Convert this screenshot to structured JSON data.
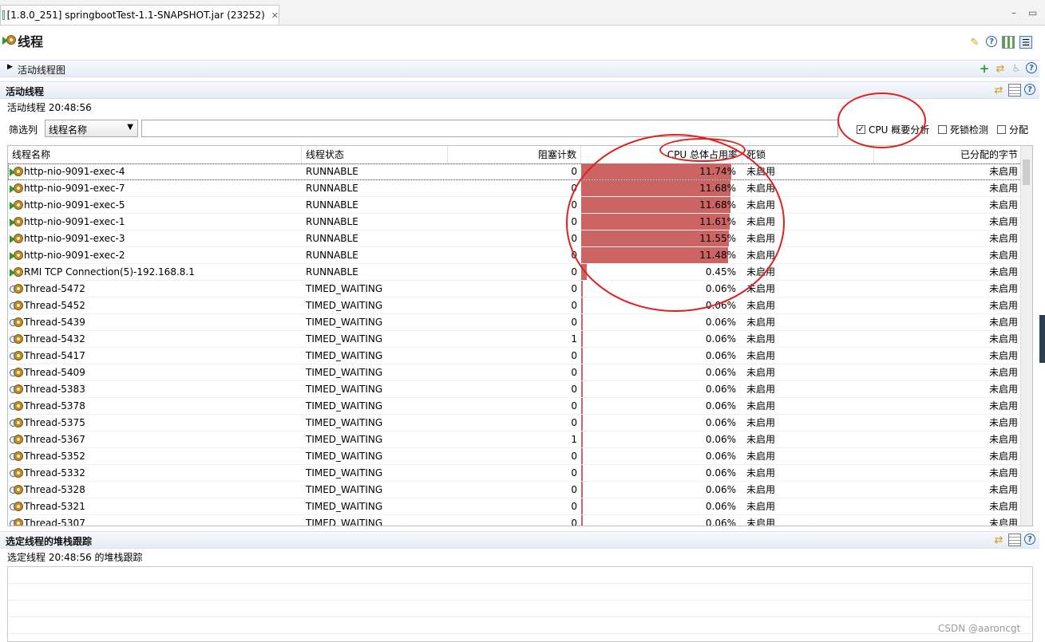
{
  "tab": {
    "title": "[1.8.0_251] springbootTest-1.1-SNAPSHOT.jar (23252)",
    "close_glyph": "✕"
  },
  "window": {
    "minimize_glyph": "–",
    "maximize_glyph": "▭"
  },
  "page": {
    "title": "线程"
  },
  "sections": {
    "thread_graph": {
      "title": "活动线程图"
    },
    "live_threads": {
      "title": "活动线程",
      "subtitle": "活动线程 20:48:56"
    },
    "stack_trace": {
      "title": "选定线程的堆栈跟踪",
      "subtitle": "选定线程 20:48:56 的堆栈跟踪"
    }
  },
  "filter": {
    "label": "筛选列",
    "column_selected": "线程名称",
    "input_value": "",
    "checkboxes": [
      {
        "label": "CPU 概要分析",
        "checked": true
      },
      {
        "label": "死锁检测",
        "checked": false
      },
      {
        "label": "分配",
        "checked": false
      }
    ]
  },
  "icons": {
    "page": "thread-icon",
    "header_toolbar": [
      "pin-icon",
      "help-icon",
      "layout-grid-icon",
      "layout-list-icon"
    ],
    "graph_toolbar": [
      "add-icon",
      "refresh-icon",
      "accessibility-icon",
      "help-icon"
    ],
    "section_toolbar": [
      "refresh-icon",
      "table-icon",
      "help-icon"
    ],
    "row_running": "running-thread-icon",
    "row_waiting": "waiting-thread-icon"
  },
  "table": {
    "columns": [
      "线程名称",
      "线程状态",
      "阻塞计数",
      "CPU 总体占用率",
      "死锁",
      "已分配的字节"
    ],
    "rows": [
      {
        "name": "http-nio-9091-exec-4",
        "state": "RUNNABLE",
        "blocked": "0",
        "cpu": "11.74%",
        "cpu_value": 11.74,
        "deadlock": "未启用",
        "bytes": "未启用",
        "running": true
      },
      {
        "name": "http-nio-9091-exec-7",
        "state": "RUNNABLE",
        "blocked": "0",
        "cpu": "11.68%",
        "cpu_value": 11.68,
        "deadlock": "未启用",
        "bytes": "未启用",
        "running": true
      },
      {
        "name": "http-nio-9091-exec-5",
        "state": "RUNNABLE",
        "blocked": "0",
        "cpu": "11.68%",
        "cpu_value": 11.68,
        "deadlock": "未启用",
        "bytes": "未启用",
        "running": true
      },
      {
        "name": "http-nio-9091-exec-1",
        "state": "RUNNABLE",
        "blocked": "0",
        "cpu": "11.61%",
        "cpu_value": 11.61,
        "deadlock": "未启用",
        "bytes": "未启用",
        "running": true
      },
      {
        "name": "http-nio-9091-exec-3",
        "state": "RUNNABLE",
        "blocked": "0",
        "cpu": "11.55%",
        "cpu_value": 11.55,
        "deadlock": "未启用",
        "bytes": "未启用",
        "running": true
      },
      {
        "name": "http-nio-9091-exec-2",
        "state": "RUNNABLE",
        "blocked": "0",
        "cpu": "11.48%",
        "cpu_value": 11.48,
        "deadlock": "未启用",
        "bytes": "未启用",
        "running": true
      },
      {
        "name": "RMI TCP Connection(5)-192.168.8.1",
        "state": "RUNNABLE",
        "blocked": "0",
        "cpu": "0.45%",
        "cpu_value": 0.45,
        "deadlock": "未启用",
        "bytes": "未启用",
        "running": true
      },
      {
        "name": "Thread-5472",
        "state": "TIMED_WAITING",
        "blocked": "0",
        "cpu": "0.06%",
        "cpu_value": 0.06,
        "deadlock": "未启用",
        "bytes": "未启用",
        "running": false
      },
      {
        "name": "Thread-5452",
        "state": "TIMED_WAITING",
        "blocked": "0",
        "cpu": "0.06%",
        "cpu_value": 0.06,
        "deadlock": "未启用",
        "bytes": "未启用",
        "running": false
      },
      {
        "name": "Thread-5439",
        "state": "TIMED_WAITING",
        "blocked": "0",
        "cpu": "0.06%",
        "cpu_value": 0.06,
        "deadlock": "未启用",
        "bytes": "未启用",
        "running": false
      },
      {
        "name": "Thread-5432",
        "state": "TIMED_WAITING",
        "blocked": "1",
        "cpu": "0.06%",
        "cpu_value": 0.06,
        "deadlock": "未启用",
        "bytes": "未启用",
        "running": false
      },
      {
        "name": "Thread-5417",
        "state": "TIMED_WAITING",
        "blocked": "0",
        "cpu": "0.06%",
        "cpu_value": 0.06,
        "deadlock": "未启用",
        "bytes": "未启用",
        "running": false
      },
      {
        "name": "Thread-5409",
        "state": "TIMED_WAITING",
        "blocked": "0",
        "cpu": "0.06%",
        "cpu_value": 0.06,
        "deadlock": "未启用",
        "bytes": "未启用",
        "running": false
      },
      {
        "name": "Thread-5383",
        "state": "TIMED_WAITING",
        "blocked": "0",
        "cpu": "0.06%",
        "cpu_value": 0.06,
        "deadlock": "未启用",
        "bytes": "未启用",
        "running": false
      },
      {
        "name": "Thread-5378",
        "state": "TIMED_WAITING",
        "blocked": "0",
        "cpu": "0.06%",
        "cpu_value": 0.06,
        "deadlock": "未启用",
        "bytes": "未启用",
        "running": false
      },
      {
        "name": "Thread-5375",
        "state": "TIMED_WAITING",
        "blocked": "0",
        "cpu": "0.06%",
        "cpu_value": 0.06,
        "deadlock": "未启用",
        "bytes": "未启用",
        "running": false
      },
      {
        "name": "Thread-5367",
        "state": "TIMED_WAITING",
        "blocked": "1",
        "cpu": "0.06%",
        "cpu_value": 0.06,
        "deadlock": "未启用",
        "bytes": "未启用",
        "running": false
      },
      {
        "name": "Thread-5352",
        "state": "TIMED_WAITING",
        "blocked": "0",
        "cpu": "0.06%",
        "cpu_value": 0.06,
        "deadlock": "未启用",
        "bytes": "未启用",
        "running": false
      },
      {
        "name": "Thread-5332",
        "state": "TIMED_WAITING",
        "blocked": "0",
        "cpu": "0.06%",
        "cpu_value": 0.06,
        "deadlock": "未启用",
        "bytes": "未启用",
        "running": false
      },
      {
        "name": "Thread-5328",
        "state": "TIMED_WAITING",
        "blocked": "0",
        "cpu": "0.06%",
        "cpu_value": 0.06,
        "deadlock": "未启用",
        "bytes": "未启用",
        "running": false
      },
      {
        "name": "Thread-5321",
        "state": "TIMED_WAITING",
        "blocked": "0",
        "cpu": "0.06%",
        "cpu_value": 0.06,
        "deadlock": "未启用",
        "bytes": "未启用",
        "running": false
      },
      {
        "name": "Thread-5307",
        "state": "TIMED_WAITING",
        "blocked": "0",
        "cpu": "0.06%",
        "cpu_value": 0.06,
        "deadlock": "未启用",
        "bytes": "未启用",
        "running": false
      }
    ]
  },
  "colors": {
    "cpu_bar": "#cd6464",
    "annotation": "#e02020"
  },
  "watermark": "CSDN @aaroncgt"
}
